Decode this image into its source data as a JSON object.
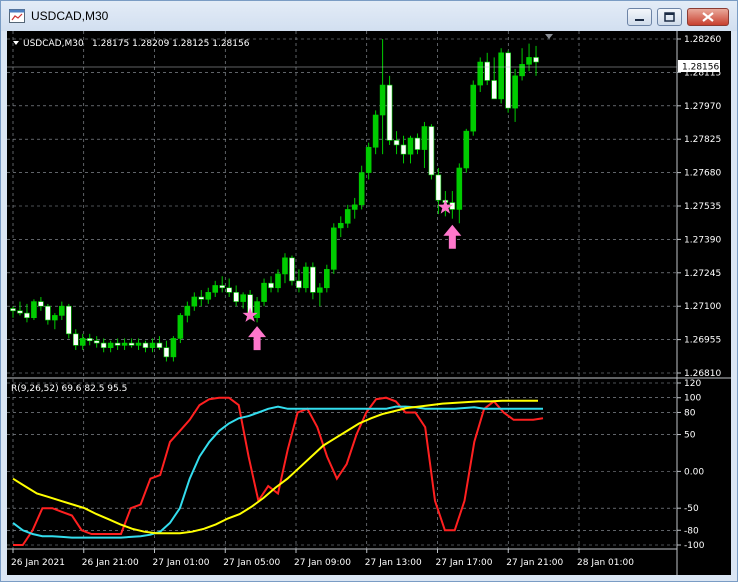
{
  "window": {
    "title": "USDCAD,M30",
    "icon": "chart-window-icon",
    "controls": [
      "minimize",
      "maximize",
      "close"
    ]
  },
  "chart_data": [
    {
      "type": "candlestick",
      "symbol_label": "USDCAD,M30",
      "ohlc_label": "1.28175 1.28209 1.28125 1.28156",
      "current_price_label": "1.28156",
      "price_ticks": [
        "1.28260",
        "1.28115",
        "1.27970",
        "1.27825",
        "1.27680",
        "1.27535",
        "1.27390",
        "1.27245",
        "1.27100",
        "1.26955",
        "1.26810"
      ],
      "ylim": [
        1.2681,
        1.2826
      ],
      "colors": {
        "up": "#00cc00",
        "down": "#ffffff",
        "background": "#000000",
        "grid": "#9aa0a8",
        "signal": "#ff77cc"
      },
      "candles": [
        [
          1.2709,
          1.271,
          1.2705,
          1.2708
        ],
        [
          1.2708,
          1.2712,
          1.2706,
          1.2707
        ],
        [
          1.2707,
          1.2711,
          1.2703,
          1.2705
        ],
        [
          1.2705,
          1.2713,
          1.2704,
          1.2712
        ],
        [
          1.2712,
          1.2714,
          1.2708,
          1.271
        ],
        [
          1.271,
          1.2711,
          1.2702,
          1.2704
        ],
        [
          1.2704,
          1.2707,
          1.27,
          1.2706
        ],
        [
          1.2706,
          1.2712,
          1.2704,
          1.271
        ],
        [
          1.271,
          1.2711,
          1.2696,
          1.2698
        ],
        [
          1.2698,
          1.27,
          1.2691,
          1.2693
        ],
        [
          1.2693,
          1.2698,
          1.2691,
          1.2696
        ],
        [
          1.2696,
          1.2698,
          1.2693,
          1.2695
        ],
        [
          1.2695,
          1.2697,
          1.2692,
          1.2694
        ],
        [
          1.2694,
          1.2696,
          1.269,
          1.2692
        ],
        [
          1.2692,
          1.2695,
          1.269,
          1.2694
        ],
        [
          1.2694,
          1.2696,
          1.2691,
          1.2693
        ],
        [
          1.2693,
          1.2696,
          1.2691,
          1.2694
        ],
        [
          1.2694,
          1.2696,
          1.2692,
          1.2693
        ],
        [
          1.2693,
          1.2696,
          1.2691,
          1.2694
        ],
        [
          1.2694,
          1.2695,
          1.269,
          1.2692
        ],
        [
          1.2692,
          1.2696,
          1.269,
          1.2694
        ],
        [
          1.2694,
          1.2697,
          1.2691,
          1.2692
        ],
        [
          1.2692,
          1.2695,
          1.2686,
          1.2688
        ],
        [
          1.2688,
          1.2697,
          1.2686,
          1.2696
        ],
        [
          1.2696,
          1.2707,
          1.2694,
          1.2706
        ],
        [
          1.2706,
          1.2712,
          1.2703,
          1.271
        ],
        [
          1.271,
          1.2716,
          1.2708,
          1.2714
        ],
        [
          1.2714,
          1.2717,
          1.271,
          1.2713
        ],
        [
          1.2713,
          1.2718,
          1.2711,
          1.2716
        ],
        [
          1.2716,
          1.2721,
          1.2714,
          1.2719
        ],
        [
          1.2719,
          1.2723,
          1.2716,
          1.2718
        ],
        [
          1.2718,
          1.2722,
          1.2714,
          1.2716
        ],
        [
          1.2716,
          1.2719,
          1.271,
          1.2712
        ],
        [
          1.2712,
          1.2716,
          1.2709,
          1.2715
        ],
        [
          1.2715,
          1.2717,
          1.2704,
          1.2705
        ],
        [
          1.2705,
          1.2714,
          1.2703,
          1.2712
        ],
        [
          1.2712,
          1.2722,
          1.271,
          1.272
        ],
        [
          1.272,
          1.2723,
          1.2716,
          1.2718
        ],
        [
          1.2718,
          1.2726,
          1.2716,
          1.2724
        ],
        [
          1.2724,
          1.2733,
          1.272,
          1.2731
        ],
        [
          1.2731,
          1.2732,
          1.2719,
          1.2721
        ],
        [
          1.2721,
          1.2726,
          1.2716,
          1.2718
        ],
        [
          1.2718,
          1.2729,
          1.2716,
          1.2727
        ],
        [
          1.2727,
          1.2729,
          1.2713,
          1.2716
        ],
        [
          1.2716,
          1.272,
          1.271,
          1.2718
        ],
        [
          1.2718,
          1.2728,
          1.2716,
          1.2726
        ],
        [
          1.2726,
          1.2746,
          1.2724,
          1.2744
        ],
        [
          1.2744,
          1.2749,
          1.274,
          1.2746
        ],
        [
          1.2746,
          1.2754,
          1.2744,
          1.2752
        ],
        [
          1.2752,
          1.2757,
          1.2748,
          1.2754
        ],
        [
          1.2754,
          1.2771,
          1.2752,
          1.2768
        ],
        [
          1.2768,
          1.2781,
          1.2765,
          1.2779
        ],
        [
          1.2779,
          1.2795,
          1.2776,
          1.2793
        ],
        [
          1.2793,
          1.2826,
          1.2776,
          1.2806
        ],
        [
          1.2806,
          1.281,
          1.278,
          1.2782
        ],
        [
          1.2782,
          1.2786,
          1.2776,
          1.278
        ],
        [
          1.278,
          1.2784,
          1.2772,
          1.2776
        ],
        [
          1.2776,
          1.2784,
          1.2772,
          1.2783
        ],
        [
          1.2783,
          1.2785,
          1.2776,
          1.2778
        ],
        [
          1.2778,
          1.279,
          1.277,
          1.2788
        ],
        [
          1.2788,
          1.2789,
          1.2765,
          1.2767
        ],
        [
          1.2767,
          1.277,
          1.275,
          1.2756
        ],
        [
          1.2756,
          1.276,
          1.2749,
          1.2755
        ],
        [
          1.2755,
          1.276,
          1.2748,
          1.2752
        ],
        [
          1.2752,
          1.2772,
          1.2746,
          1.277
        ],
        [
          1.277,
          1.2787,
          1.2768,
          1.2786
        ],
        [
          1.2786,
          1.2808,
          1.2784,
          1.2806
        ],
        [
          1.2806,
          1.2818,
          1.2803,
          1.2816
        ],
        [
          1.2816,
          1.282,
          1.2806,
          1.2808
        ],
        [
          1.2808,
          1.2818,
          1.2801,
          1.28
        ],
        [
          1.28,
          1.2822,
          1.2798,
          1.282
        ],
        [
          1.282,
          1.2821,
          1.2794,
          1.2796
        ],
        [
          1.2796,
          1.2813,
          1.279,
          1.281
        ],
        [
          1.281,
          1.2822,
          1.2808,
          1.2815
        ],
        [
          1.2815,
          1.2824,
          1.2812,
          1.2818
        ],
        [
          1.2818,
          1.2823,
          1.281,
          1.2816
        ]
      ],
      "signals": [
        {
          "candle": 34,
          "price": 1.2706,
          "kind": "star"
        },
        {
          "candle": 35,
          "price": 1.2697,
          "kind": "up-arrow"
        },
        {
          "candle": 62,
          "price": 1.2753,
          "kind": "star"
        },
        {
          "candle": 63,
          "price": 1.2741,
          "kind": "up-arrow"
        }
      ]
    },
    {
      "type": "line",
      "label": "R(9,26,52) 69.6 82.5 95.5",
      "ylim": [
        -100,
        120
      ],
      "ticks": [
        "120",
        "100",
        "80",
        "50",
        "0.00",
        "-50",
        "-80",
        "-100"
      ],
      "tick_values": [
        120,
        100,
        80,
        50,
        0,
        -50,
        -80,
        -100
      ],
      "series": [
        {
          "color": "#ff2020",
          "values": [
            -100,
            -100,
            -80,
            -50,
            -50,
            -55,
            -60,
            -80,
            -85,
            -85,
            -85,
            -85,
            -50,
            -45,
            -10,
            -5,
            40,
            55,
            70,
            90,
            98,
            100,
            100,
            90,
            20,
            -40,
            -20,
            -30,
            30,
            80,
            85,
            60,
            20,
            -10,
            10,
            50,
            80,
            98,
            100,
            95,
            80,
            80,
            60,
            -40,
            -80,
            -80,
            -40,
            40,
            85,
            95,
            80,
            70,
            70,
            70,
            72
          ]
        },
        {
          "color": "#33ddee",
          "values": [
            -70,
            -80,
            -85,
            -88,
            -88,
            -89,
            -90,
            -90,
            -90,
            -90,
            -90,
            -90,
            -89,
            -88,
            -86,
            -82,
            -70,
            -50,
            -10,
            20,
            40,
            55,
            65,
            72,
            75,
            80,
            85,
            88,
            85,
            85,
            85,
            85,
            85,
            85,
            85,
            85,
            85,
            85,
            85,
            88,
            88,
            87,
            85,
            85,
            85,
            85,
            86,
            87,
            85,
            85,
            85,
            85,
            85,
            85,
            85
          ]
        },
        {
          "color": "#ffff00",
          "values": [
            -10,
            -20,
            -30,
            -35,
            -40,
            -45,
            -50,
            -58,
            -65,
            -72,
            -78,
            -82,
            -84,
            -84,
            -84,
            -82,
            -78,
            -72,
            -64,
            -58,
            -48,
            -36,
            -22,
            -10,
            5,
            20,
            35,
            45,
            55,
            65,
            72,
            78,
            82,
            86,
            88,
            90,
            92,
            93,
            94,
            95,
            95,
            96,
            96,
            96,
            96
          ]
        }
      ],
      "time_labels": [
        "26 Jan 2021",
        "26 Jan 21:00",
        "27 Jan 01:00",
        "27 Jan 05:00",
        "27 Jan 09:00",
        "27 Jan 13:00",
        "27 Jan 17:00",
        "27 Jan 21:00",
        "28 Jan 01:00"
      ]
    }
  ]
}
